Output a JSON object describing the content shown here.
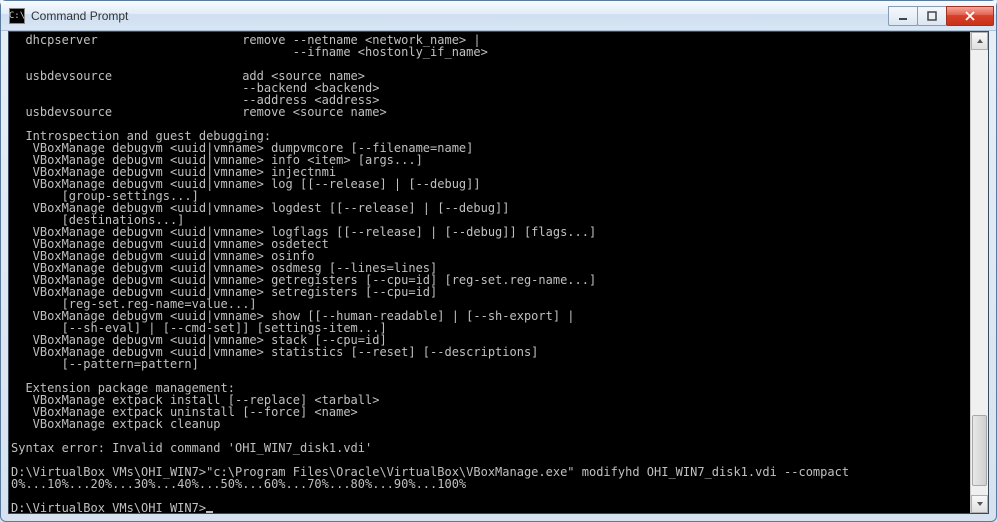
{
  "window": {
    "icon_text": "C:\\",
    "title": "Command Prompt"
  },
  "console_lines": [
    "  dhcpserver                    remove --netname <network_name> |",
    "                                       --ifname <hostonly_if_name>",
    "",
    "  usbdevsource                  add <source name>",
    "                                --backend <backend>",
    "                                --address <address>",
    "  usbdevsource                  remove <source name>",
    "",
    "  Introspection and guest debugging:",
    "   VBoxManage debugvm <uuid|vmname> dumpvmcore [--filename=name]",
    "   VBoxManage debugvm <uuid|vmname> info <item> [args...]",
    "   VBoxManage debugvm <uuid|vmname> injectnmi",
    "   VBoxManage debugvm <uuid|vmname> log [[--release] | [--debug]]",
    "       [group-settings...]",
    "   VBoxManage debugvm <uuid|vmname> logdest [[--release] | [--debug]]",
    "       [destinations...]",
    "   VBoxManage debugvm <uuid|vmname> logflags [[--release] | [--debug]] [flags...]",
    "   VBoxManage debugvm <uuid|vmname> osdetect",
    "   VBoxManage debugvm <uuid|vmname> osinfo",
    "   VBoxManage debugvm <uuid|vmname> osdmesg [--lines=lines]",
    "   VBoxManage debugvm <uuid|vmname> getregisters [--cpu=id] [reg-set.reg-name...]",
    "   VBoxManage debugvm <uuid|vmname> setregisters [--cpu=id]",
    "       [reg-set.reg-name=value...]",
    "   VBoxManage debugvm <uuid|vmname> show [[--human-readable] | [--sh-export] |",
    "       [--sh-eval] | [--cmd-set]] [settings-item...]",
    "   VBoxManage debugvm <uuid|vmname> stack [--cpu=id]",
    "   VBoxManage debugvm <uuid|vmname> statistics [--reset] [--descriptions]",
    "       [--pattern=pattern]",
    "",
    "  Extension package management:",
    "   VBoxManage extpack install [--replace] <tarball>",
    "   VBoxManage extpack uninstall [--force] <name>",
    "   VBoxManage extpack cleanup",
    "",
    "Syntax error: Invalid command 'OHI_WIN7_disk1.vdi'",
    "",
    "D:\\VirtualBox VMs\\OHI_WIN7>\"c:\\Program Files\\Oracle\\VirtualBox\\VBoxManage.exe\" modifyhd OHI_WIN7_disk1.vdi --compact",
    "0%...10%...20%...30%...40%...50%...60%...70%...80%...90%...100%",
    "",
    "D:\\VirtualBox VMs\\OHI_WIN7>"
  ],
  "prompt_cursor": "_"
}
